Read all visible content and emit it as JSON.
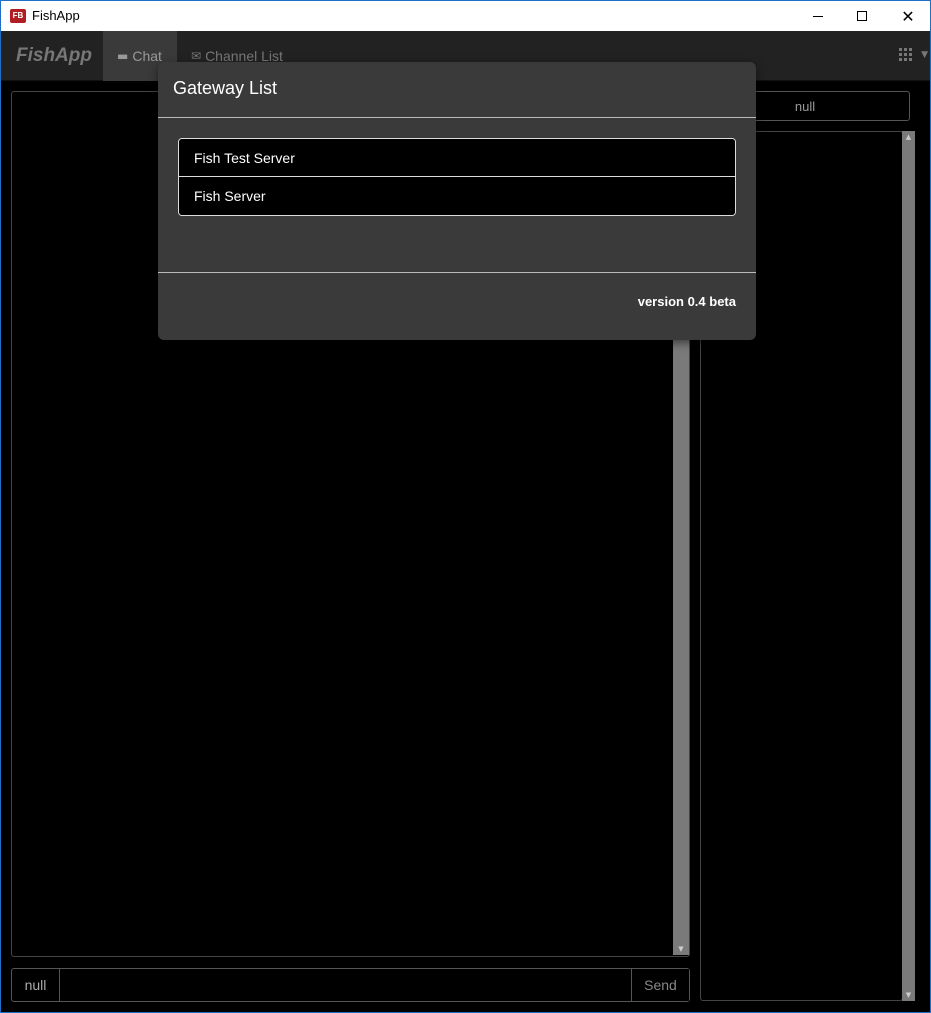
{
  "window": {
    "title": "FishApp",
    "logo_text": "FB"
  },
  "navbar": {
    "brand": "FishApp",
    "tabs": [
      {
        "label": "Chat",
        "icon": "comment-icon"
      },
      {
        "label": "Channel List",
        "icon": "envelope-icon"
      }
    ],
    "menu_icon": "grid-icon"
  },
  "chat": {
    "nickname_addon": "null",
    "input_value": "",
    "send_label": "Send"
  },
  "right_panel": {
    "header_label": "null"
  },
  "modal": {
    "title": "Gateway List",
    "gateways": [
      {
        "label": "Fish Test Server"
      },
      {
        "label": "Fish Server"
      }
    ],
    "version": "version 0.4 beta"
  }
}
